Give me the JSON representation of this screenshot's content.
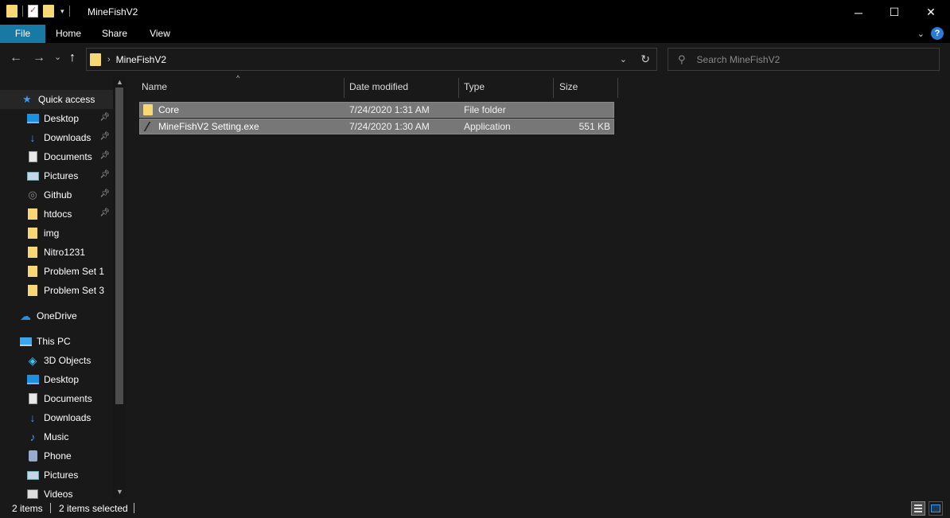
{
  "window": {
    "title": "MineFishV2",
    "minimize_glyph": "─",
    "maximize_glyph": "☐",
    "close_glyph": "✕"
  },
  "ribbon": {
    "tabs": [
      "File",
      "Home",
      "Share",
      "View"
    ],
    "accent": "#1979a5",
    "help_glyph": "?"
  },
  "address": {
    "crumbs": [
      "MineFishV2"
    ],
    "back_glyph": "←",
    "forward_glyph": "→",
    "recent_glyph": "⌄",
    "up_glyph": "↑",
    "refresh_glyph": "↻"
  },
  "search": {
    "placeholder": "Search MineFishV2",
    "value": ""
  },
  "sidebar": {
    "items": [
      {
        "label": "Quick access",
        "icon": "star-icon",
        "pinned": false,
        "active": true
      },
      {
        "label": "Desktop",
        "icon": "desktop-icon",
        "pinned": true
      },
      {
        "label": "Downloads",
        "icon": "download-icon",
        "pinned": true
      },
      {
        "label": "Documents",
        "icon": "document-icon",
        "pinned": true
      },
      {
        "label": "Pictures",
        "icon": "pictures-icon",
        "pinned": true
      },
      {
        "label": "Github",
        "icon": "github-icon",
        "pinned": true
      },
      {
        "label": "htdocs",
        "icon": "folder-icon",
        "pinned": true
      },
      {
        "label": "img",
        "icon": "folder-icon",
        "pinned": false
      },
      {
        "label": "Nitro1231",
        "icon": "folder-icon",
        "pinned": false
      },
      {
        "label": "Problem Set 1",
        "icon": "folder-icon",
        "pinned": false
      },
      {
        "label": "Problem Set 3",
        "icon": "folder-icon",
        "pinned": false
      },
      {
        "label": "OneDrive",
        "icon": "cloud-icon",
        "pinned": false
      },
      {
        "label": "This PC",
        "icon": "computer-icon",
        "pinned": false
      },
      {
        "label": "3D Objects",
        "icon": "cube-icon",
        "pinned": false
      },
      {
        "label": "Desktop",
        "icon": "desktop-icon",
        "pinned": false
      },
      {
        "label": "Documents",
        "icon": "document-icon",
        "pinned": false
      },
      {
        "label": "Downloads",
        "icon": "download-icon",
        "pinned": false
      },
      {
        "label": "Music",
        "icon": "music-icon",
        "pinned": false
      },
      {
        "label": "Phone",
        "icon": "phone-icon",
        "pinned": false
      },
      {
        "label": "Pictures",
        "icon": "pictures-icon",
        "pinned": false
      },
      {
        "label": "Videos",
        "icon": "video-icon",
        "pinned": false
      }
    ]
  },
  "columns": {
    "name": "Name",
    "date": "Date modified",
    "type": "Type",
    "size": "Size"
  },
  "files": [
    {
      "name": "Core",
      "date": "7/24/2020 1:31 AM",
      "type": "File folder",
      "size": "",
      "icon": "folder-icon"
    },
    {
      "name": "MineFishV2 Setting.exe",
      "date": "7/24/2020 1:30 AM",
      "type": "Application",
      "size": "551 KB",
      "icon": "application-icon"
    }
  ],
  "status": {
    "items": "2 items",
    "selected": "2 items selected"
  }
}
